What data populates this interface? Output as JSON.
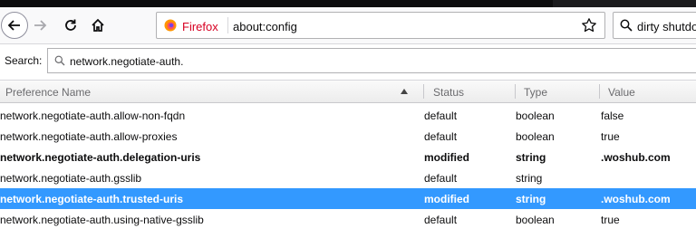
{
  "browser": {
    "brand": "Firefox",
    "url": "about:config",
    "search_query": "dirty shutdown"
  },
  "config_page": {
    "search_label": "Search:",
    "search_value": "network.negotiate-auth.",
    "columns": {
      "name": "Preference Name",
      "status": "Status",
      "type": "Type",
      "value": "Value"
    },
    "rows": [
      {
        "name": "network.negotiate-auth.allow-non-fqdn",
        "status": "default",
        "type": "boolean",
        "value": "false",
        "modified": false,
        "selected": false
      },
      {
        "name": "network.negotiate-auth.allow-proxies",
        "status": "default",
        "type": "boolean",
        "value": "true",
        "modified": false,
        "selected": false
      },
      {
        "name": "network.negotiate-auth.delegation-uris",
        "status": "modified",
        "type": "string",
        "value": ".woshub.com",
        "modified": true,
        "selected": false
      },
      {
        "name": "network.negotiate-auth.gsslib",
        "status": "default",
        "type": "string",
        "value": "",
        "modified": false,
        "selected": false
      },
      {
        "name": "network.negotiate-auth.trusted-uris",
        "status": "modified",
        "type": "string",
        "value": ".woshub.com",
        "modified": true,
        "selected": true
      },
      {
        "name": "network.negotiate-auth.using-native-gsslib",
        "status": "default",
        "type": "boolean",
        "value": "true",
        "modified": false,
        "selected": false
      }
    ]
  },
  "colors": {
    "selection": "#3399ff",
    "firefox_brand": "#d70022"
  },
  "icons": [
    "back-arrow-icon",
    "forward-arrow-icon",
    "reload-icon",
    "home-icon",
    "firefox-logo-icon",
    "bookmark-star-icon",
    "search-icon",
    "sort-ascending-icon"
  ]
}
